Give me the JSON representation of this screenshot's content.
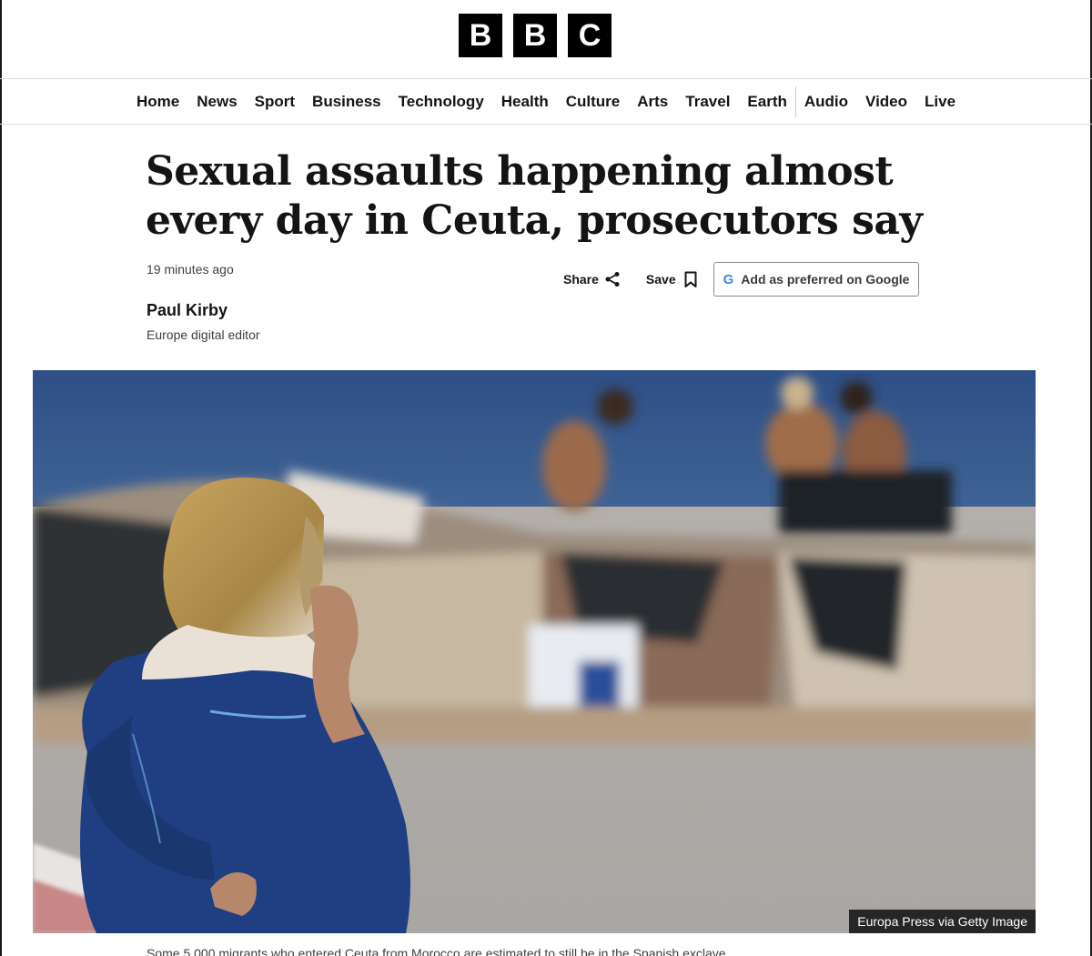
{
  "logo": {
    "letters": [
      "B",
      "B",
      "C"
    ]
  },
  "nav": {
    "items": [
      "Home",
      "News",
      "Sport",
      "Business",
      "Technology",
      "Health",
      "Culture",
      "Arts",
      "Travel",
      "Earth",
      "Audio",
      "Video",
      "Live"
    ]
  },
  "article": {
    "headline": "Sexual assaults happening almost every day in Ceuta, prosecutors say",
    "timestamp": "19 minutes ago",
    "author": {
      "name": "Paul Kirby",
      "role": "Europe digital editor"
    },
    "image_credit": "Europa Press via Getty Image",
    "caption": "Some 5,000 migrants who entered Ceuta from Morocco are estimated to still be in the Spanish exclave"
  },
  "actions": {
    "share_label": "Share",
    "save_label": "Save",
    "google_label": "Add as preferred on Google",
    "google_icon": "G"
  },
  "icons": {
    "share": "share-icon",
    "save": "bookmark-icon",
    "google": "google-icon"
  }
}
